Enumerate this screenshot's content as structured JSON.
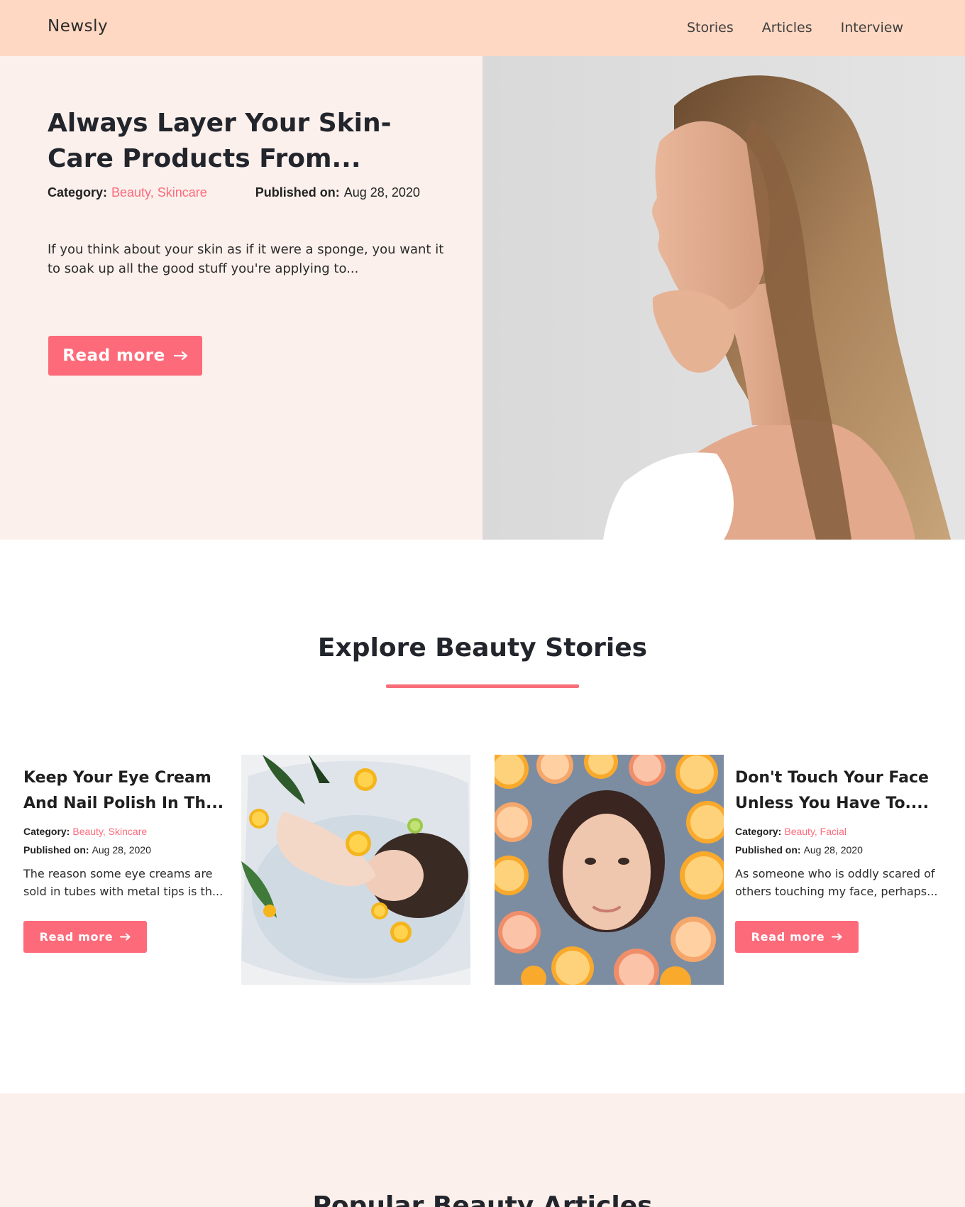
{
  "navbar": {
    "brand": "Newsly",
    "links": [
      "Stories",
      "Articles",
      "Interview"
    ]
  },
  "hero": {
    "title": "Always Layer Your Skin-Care Products From...",
    "category_label": "Category:",
    "categories": "Beauty, Skincare",
    "published_label": "Published on:",
    "published_date": "Aug 28, 2020",
    "excerpt": "If you think about your skin as if it were a sponge, you want it to soak up all the good stuff you're applying to...",
    "button_label": "Read more",
    "button_icon": "arrow-right-icon"
  },
  "explore": {
    "title": "Explore Beauty Stories",
    "cards": [
      {
        "title": "Keep Your Eye Cream And Nail Polish In Th...",
        "category_label": "Category:",
        "categories": "Beauty, Skincare",
        "published_label": "Published on:",
        "published_date": "Aug 28, 2020",
        "excerpt": "The reason some eye creams are sold in tubes with metal tips is th...",
        "button_label": "Read more"
      },
      {
        "title": "Don't Touch Your Face Unless You Have To....",
        "category_label": "Category:",
        "categories": "Beauty, Facial",
        "published_label": "Published on:",
        "published_date": "Aug 28, 2020",
        "excerpt": "As someone who is oddly scared of others touching my face, perhaps...",
        "button_label": "Read more"
      }
    ]
  },
  "popular": {
    "title": "Popular Beauty Articles"
  },
  "colors": {
    "navbar_bg": "#ffd8c3",
    "hero_bg": "#fbf0ec",
    "accent": "#fd6b7b",
    "text": "#22252b"
  }
}
